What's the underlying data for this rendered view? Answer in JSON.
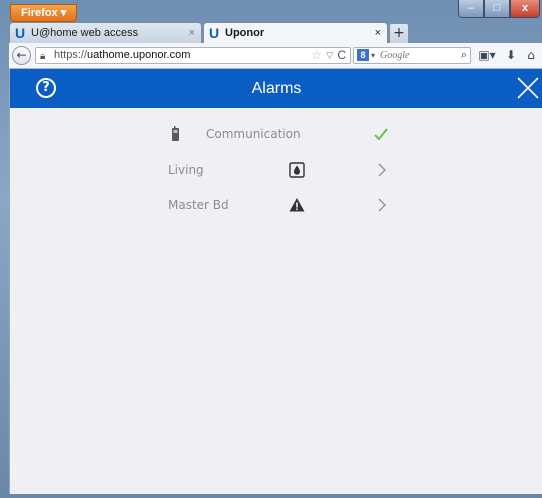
{
  "browser": {
    "app_button": "Firefox",
    "tabs": [
      {
        "label": "U@home web access",
        "close": "×"
      },
      {
        "label": "Uponor",
        "close": "×"
      }
    ],
    "new_tab": "+",
    "url_prefix": "https://",
    "url_host": "uathome.uponor.com",
    "search_engine_letter": "8",
    "search_placeholder": "Google"
  },
  "app": {
    "title": "Alarms",
    "help_symbol": "?",
    "rows": [
      {
        "label": "Communication",
        "icon": "phone-icon",
        "status": "ok-check-icon"
      },
      {
        "label": "Living",
        "icon": "humidity-alarm-icon",
        "status": "chevron-right-icon"
      },
      {
        "label": "Master Bd",
        "icon": "warning-icon",
        "status": "chevron-right-icon"
      }
    ]
  },
  "colors": {
    "header_bg": "#0a5dc2",
    "page_bg": "#eef0f3",
    "check_green": "#6cc04a",
    "label_gray": "#8c8c8c"
  }
}
